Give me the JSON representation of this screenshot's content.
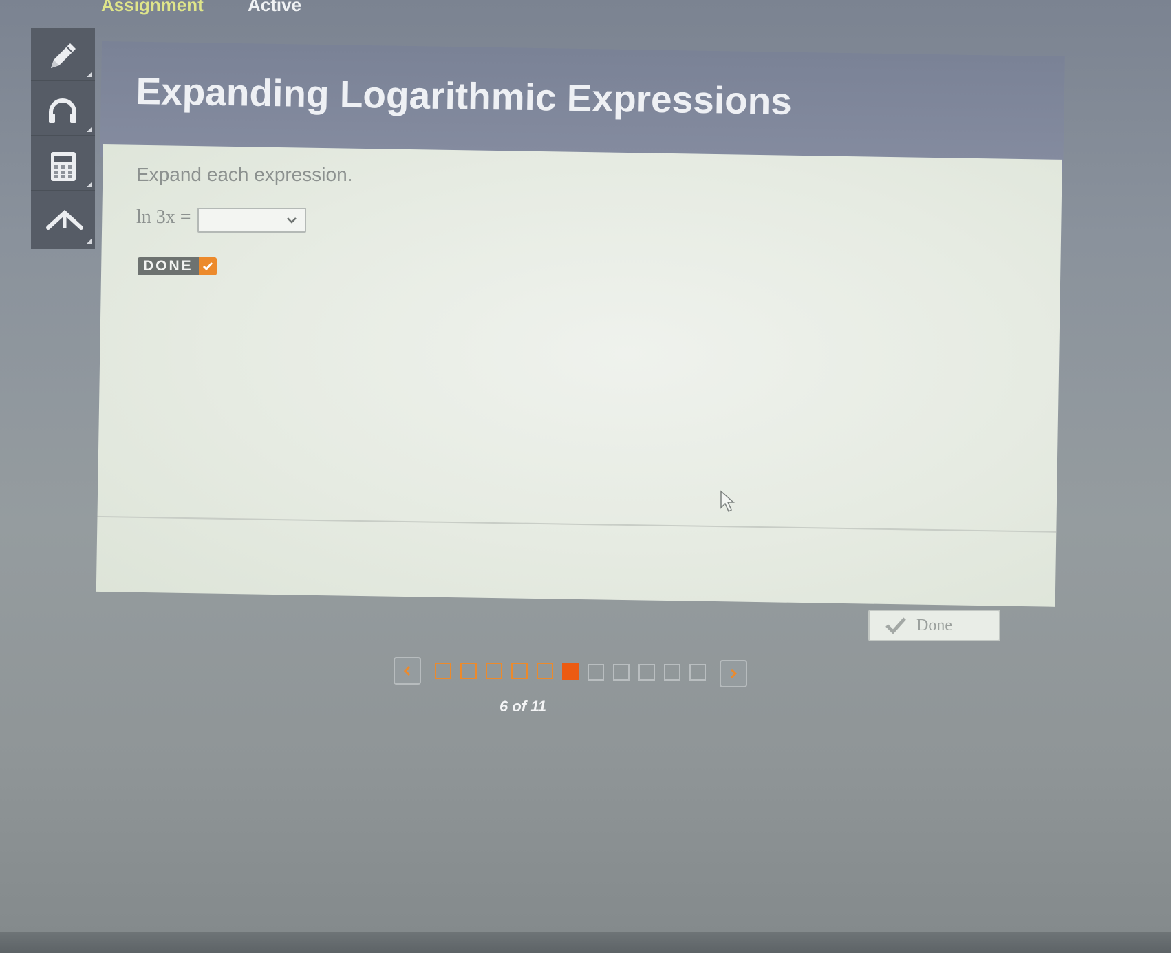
{
  "top_tabs": {
    "assignment": "Assignment",
    "active": "Active"
  },
  "toolbar": {
    "tools": [
      "pencil-icon",
      "headphones-icon",
      "calculator-icon",
      "collapse-up-icon"
    ]
  },
  "panel": {
    "title": "Expanding Logarithmic Expressions",
    "instruction": "Expand each expression.",
    "equation_label": "ln 3x =",
    "answer_value": "",
    "done_badge": "DONE"
  },
  "footer": {
    "done_button_label": "Done"
  },
  "pager": {
    "current": 6,
    "total": 11,
    "label": "6 of 11"
  },
  "colors": {
    "accent": "#ec8a2c",
    "assignment_tab": "#dfe58a",
    "header_bg": "#7a8296",
    "body_bg": "#e6ebe2"
  }
}
